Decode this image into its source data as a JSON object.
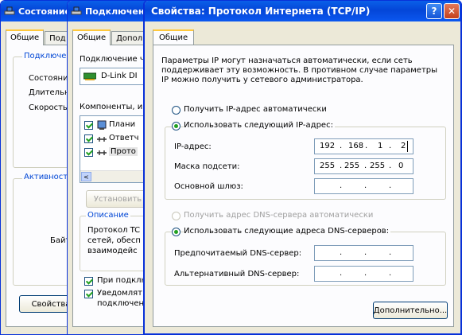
{
  "status_window": {
    "title": "Состояние",
    "tabs": [
      "Общие",
      "Под"
    ],
    "group_connection": "Подключе",
    "rows": [
      "Состояни",
      "Длительн",
      "Скорость"
    ],
    "group_activity": "Активност",
    "bytes_label": "Байт:",
    "properties_button": "Свойства"
  },
  "connection_window": {
    "title": "Подключен",
    "tabs": [
      "Общие",
      "Дополн"
    ],
    "connect_using": "Подключение ч",
    "adapter": "D-Link DI",
    "components_label": "Компоненты, и",
    "components": [
      "Плани",
      "Ответч",
      "Прото"
    ],
    "install_button": "Установить",
    "description_title": "Описание",
    "description_text": [
      "Протокол TC",
      "сетей, обесп",
      "взаимодейс"
    ],
    "show_icon_text": "При подклю",
    "notify_text": [
      "Уведомлят",
      "подключени"
    ]
  },
  "tcpip_dialog": {
    "title": "Свойства: Протокол Интернета (TCP/IP)",
    "help_button": "?",
    "close_button": "✕",
    "tab": "Общие",
    "intro": [
      "Параметры IP могут назначаться автоматически, если сеть",
      "поддерживает эту возможность. В противном случае параметры",
      "IP можно получить у сетевого администратора."
    ],
    "radio_auto_ip": "Получить IP-адрес автоматически",
    "radio_manual_ip": "Использовать следующий IP-адрес:",
    "ip_label": "IP-адрес:",
    "ip_value": [
      "192",
      "168",
      "1",
      "2"
    ],
    "mask_label": "Маска подсети:",
    "mask_value": [
      "255",
      "255",
      "255",
      "0"
    ],
    "gateway_label": "Основной шлюз:",
    "radio_auto_dns": "Получить адрес DNS-сервера автоматически",
    "radio_manual_dns": "Использовать следующие адреса DNS-серверов:",
    "preferred_dns_label": "Предпочитаемый DNS-сервер:",
    "alternate_dns_label": "Альтернативный DNS-сервер:",
    "advanced_button": "Дополнительно..."
  }
}
